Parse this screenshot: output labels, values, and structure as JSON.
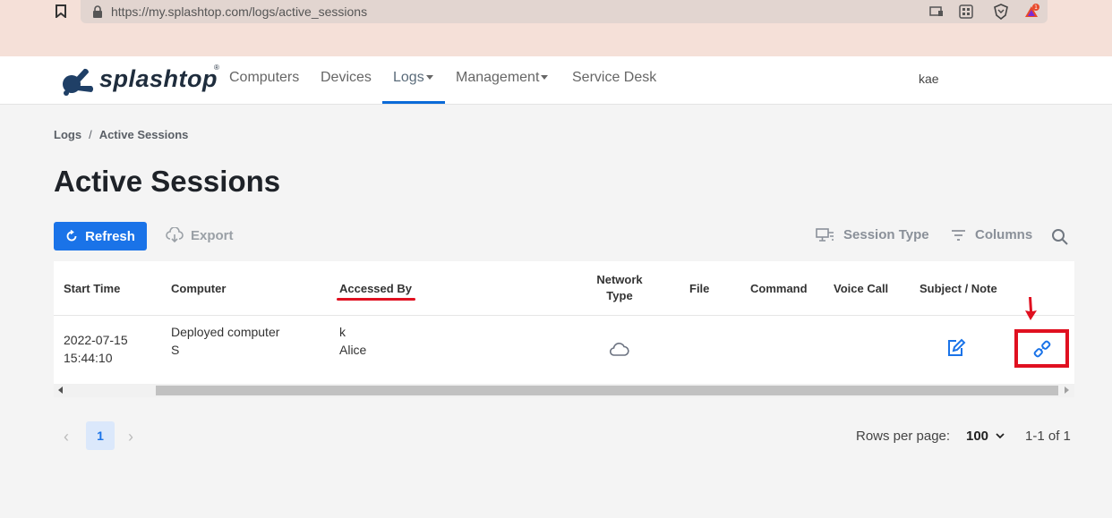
{
  "browser": {
    "url": "https://my.splashtop.com/logs/active_sessions",
    "extension_badge": "1"
  },
  "nav": {
    "brand": "splashtop",
    "brand_mark": "®",
    "items": [
      {
        "label": "Computers"
      },
      {
        "label": "Devices"
      },
      {
        "label": "Logs"
      },
      {
        "label": "Management"
      },
      {
        "label": "Service Desk"
      }
    ],
    "active": "Logs",
    "user": "kae"
  },
  "breadcrumb": {
    "parent": "Logs",
    "separator": "/",
    "current": "Active Sessions"
  },
  "page": {
    "title": "Active Sessions"
  },
  "toolbar": {
    "refresh": "Refresh",
    "export": "Export",
    "session_type": "Session Type",
    "columns": "Columns"
  },
  "table": {
    "columns": {
      "start_time": "Start Time",
      "computer": "Computer",
      "accessed_by": "Accessed By",
      "network_type_1": "Network",
      "network_type_2": "Type",
      "file": "File",
      "command": "Command",
      "voice_call": "Voice Call",
      "subject_note": "Subject / Note"
    },
    "rows": [
      {
        "start_date": "2022-07-15",
        "start_clock": "15:44:10",
        "computer_line1": "Deployed computer",
        "computer_line2": "S",
        "accessed_line1": "k",
        "accessed_line2": "Alice",
        "network_icon": "cloud-icon",
        "note_icon": "edit-note-icon",
        "action_icon": "disconnect-icon"
      }
    ]
  },
  "pagination": {
    "current_page": "1",
    "prev": "‹",
    "next": "›",
    "rows_per_page_label": "Rows per page:",
    "rows_per_page": "100",
    "range": "1-1 of 1"
  },
  "colors": {
    "accent": "#1a73e8",
    "highlight": "#e01020",
    "nav_underline": "#0a6ad8",
    "browser_bar": "#f5e0d8"
  }
}
